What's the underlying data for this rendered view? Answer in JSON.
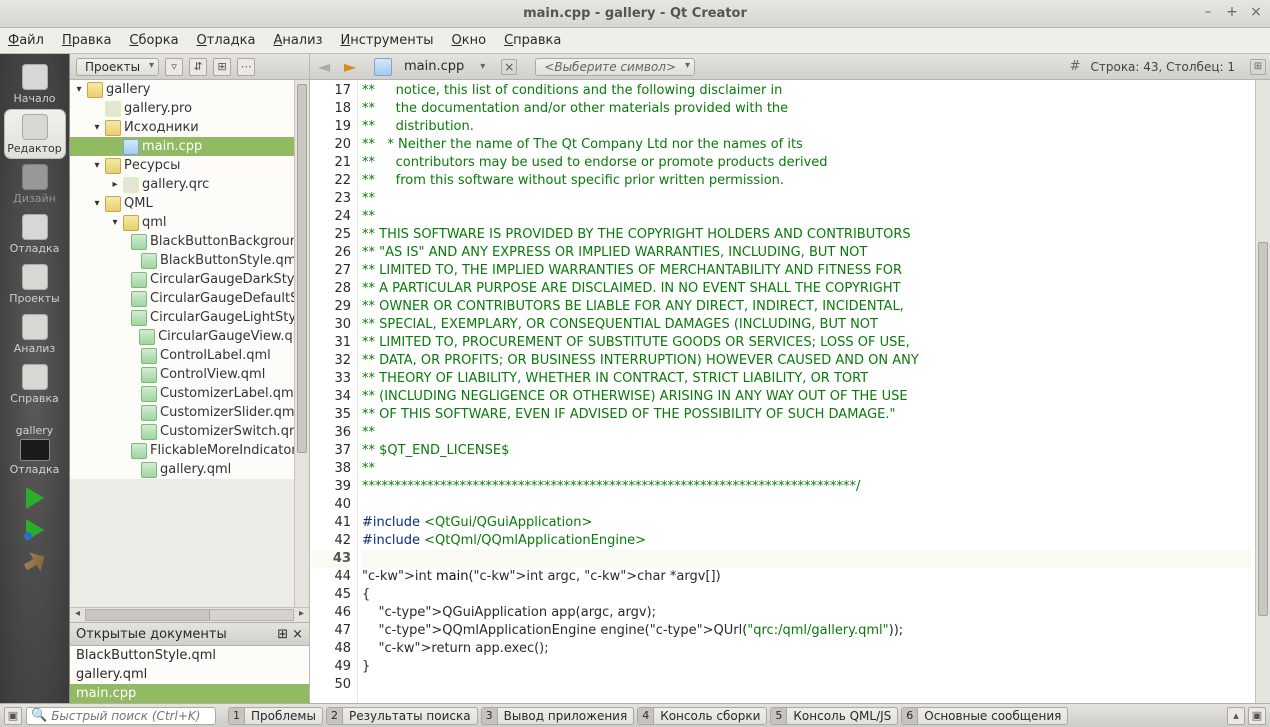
{
  "window": {
    "title": "main.cpp - gallery - Qt Creator"
  },
  "menu": [
    "Файл",
    "Правка",
    "Сборка",
    "Отладка",
    "Анализ",
    "Инструменты",
    "Окно",
    "Справка"
  ],
  "modes": [
    {
      "id": "start",
      "label": "Начало",
      "active": false
    },
    {
      "id": "editor",
      "label": "Редактор",
      "active": true
    },
    {
      "id": "design",
      "label": "Дизайн",
      "active": false,
      "disabled": true
    },
    {
      "id": "debug",
      "label": "Отладка",
      "active": false
    },
    {
      "id": "projects",
      "label": "Проекты",
      "active": false
    },
    {
      "id": "analyze",
      "label": "Анализ",
      "active": false
    },
    {
      "id": "help",
      "label": "Справка",
      "active": false
    }
  ],
  "kit": {
    "name": "gallery",
    "config": "Отладка"
  },
  "projectCombo": "Проекты",
  "tree": {
    "root": "gallery",
    "nodes": [
      {
        "indent": 0,
        "twisty": "▾",
        "icon": "folder",
        "label": "gallery"
      },
      {
        "indent": 1,
        "twisty": "",
        "icon": "pro",
        "label": "gallery.pro"
      },
      {
        "indent": 1,
        "twisty": "▾",
        "icon": "folder",
        "label": "Исходники"
      },
      {
        "indent": 2,
        "twisty": "",
        "icon": "cpp",
        "label": "main.cpp",
        "sel": true
      },
      {
        "indent": 1,
        "twisty": "▾",
        "icon": "folder",
        "label": "Ресурсы"
      },
      {
        "indent": 2,
        "twisty": "▸",
        "icon": "qrc",
        "label": "gallery.qrc"
      },
      {
        "indent": 1,
        "twisty": "▾",
        "icon": "folder",
        "label": "QML"
      },
      {
        "indent": 2,
        "twisty": "▾",
        "icon": "folder",
        "label": "qml"
      },
      {
        "indent": 3,
        "twisty": "",
        "icon": "qml",
        "label": "BlackButtonBackground.qml"
      },
      {
        "indent": 3,
        "twisty": "",
        "icon": "qml",
        "label": "BlackButtonStyle.qml"
      },
      {
        "indent": 3,
        "twisty": "",
        "icon": "qml",
        "label": "CircularGaugeDarkStyle.qml"
      },
      {
        "indent": 3,
        "twisty": "",
        "icon": "qml",
        "label": "CircularGaugeDefaultStyle.qml"
      },
      {
        "indent": 3,
        "twisty": "",
        "icon": "qml",
        "label": "CircularGaugeLightStyle.qml"
      },
      {
        "indent": 3,
        "twisty": "",
        "icon": "qml",
        "label": "CircularGaugeView.qml"
      },
      {
        "indent": 3,
        "twisty": "",
        "icon": "qml",
        "label": "ControlLabel.qml"
      },
      {
        "indent": 3,
        "twisty": "",
        "icon": "qml",
        "label": "ControlView.qml"
      },
      {
        "indent": 3,
        "twisty": "",
        "icon": "qml",
        "label": "CustomizerLabel.qml"
      },
      {
        "indent": 3,
        "twisty": "",
        "icon": "qml",
        "label": "CustomizerSlider.qml"
      },
      {
        "indent": 3,
        "twisty": "",
        "icon": "qml",
        "label": "CustomizerSwitch.qml"
      },
      {
        "indent": 3,
        "twisty": "",
        "icon": "qml",
        "label": "FlickableMoreIndicator.qml"
      },
      {
        "indent": 3,
        "twisty": "",
        "icon": "qml",
        "label": "gallery.qml"
      }
    ]
  },
  "openDocsHeader": "Открытые документы",
  "openDocs": [
    {
      "label": "BlackButtonStyle.qml"
    },
    {
      "label": "gallery.qml"
    },
    {
      "label": "main.cpp",
      "sel": true
    }
  ],
  "editor": {
    "filename": "main.cpp",
    "symbolCombo": "<Выберите символ>",
    "position": "Строка: 43, Столбец: 1",
    "startLine": 17,
    "currentLine": 43,
    "lines": [
      "**     notice, this list of conditions and the following disclaimer in",
      "**     the documentation and/or other materials provided with the",
      "**     distribution.",
      "**   * Neither the name of The Qt Company Ltd nor the names of its",
      "**     contributors may be used to endorse or promote products derived",
      "**     from this software without specific prior written permission.",
      "**",
      "**",
      "** THIS SOFTWARE IS PROVIDED BY THE COPYRIGHT HOLDERS AND CONTRIBUTORS",
      "** \"AS IS\" AND ANY EXPRESS OR IMPLIED WARRANTIES, INCLUDING, BUT NOT",
      "** LIMITED TO, THE IMPLIED WARRANTIES OF MERCHANTABILITY AND FITNESS FOR",
      "** A PARTICULAR PURPOSE ARE DISCLAIMED. IN NO EVENT SHALL THE COPYRIGHT",
      "** OWNER OR CONTRIBUTORS BE LIABLE FOR ANY DIRECT, INDIRECT, INCIDENTAL,",
      "** SPECIAL, EXEMPLARY, OR CONSEQUENTIAL DAMAGES (INCLUDING, BUT NOT",
      "** LIMITED TO, PROCUREMENT OF SUBSTITUTE GOODS OR SERVICES; LOSS OF USE,",
      "** DATA, OR PROFITS; OR BUSINESS INTERRUPTION) HOWEVER CAUSED AND ON ANY",
      "** THEORY OF LIABILITY, WHETHER IN CONTRACT, STRICT LIABILITY, OR TORT",
      "** (INCLUDING NEGLIGENCE OR OTHERWISE) ARISING IN ANY WAY OUT OF THE USE",
      "** OF THIS SOFTWARE, EVEN IF ADVISED OF THE POSSIBILITY OF SUCH DAMAGE.\"",
      "**",
      "** $QT_END_LICENSE$",
      "**",
      "****************************************************************************/",
      "",
      "#include <QtGui/QGuiApplication>",
      "#include <QtQml/QQmlApplicationEngine>",
      "",
      "int main(int argc, char *argv[])",
      "{",
      "    QGuiApplication app(argc, argv);",
      "    QQmlApplicationEngine engine(QUrl(\"qrc:/qml/gallery.qml\"));",
      "    return app.exec();",
      "}",
      ""
    ]
  },
  "status": {
    "searchPlaceholder": "Быстрый поиск (Ctrl+K)",
    "tabs": [
      {
        "n": "1",
        "label": "Проблемы"
      },
      {
        "n": "2",
        "label": "Результаты поиска"
      },
      {
        "n": "3",
        "label": "Вывод приложения"
      },
      {
        "n": "4",
        "label": "Консоль сборки"
      },
      {
        "n": "5",
        "label": "Консоль QML/JS"
      },
      {
        "n": "6",
        "label": "Основные сообщения"
      }
    ]
  }
}
